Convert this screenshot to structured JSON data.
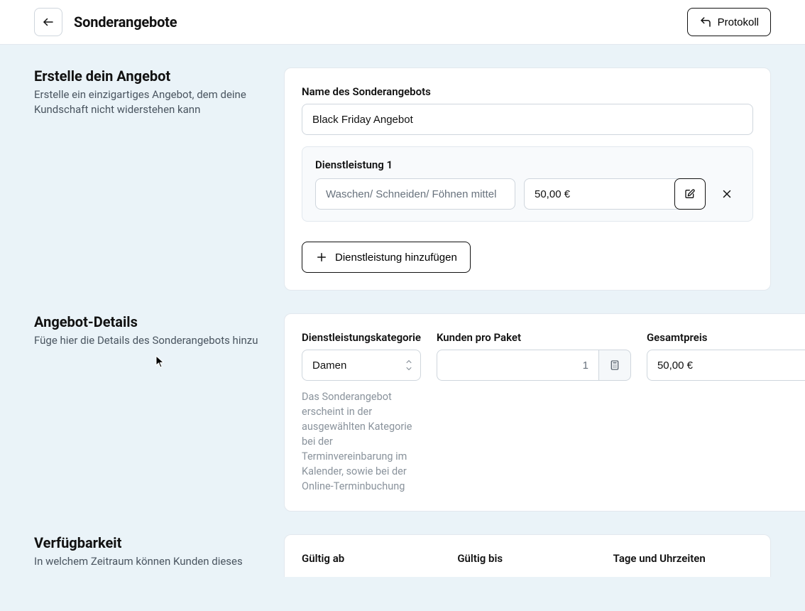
{
  "header": {
    "title": "Sonderangebote",
    "protocol_label": "Protokoll"
  },
  "section1": {
    "heading": "Erstelle dein Angebot",
    "desc": "Erstelle ein einzigartiges Angebot, dem deine Kundschaft nicht widerstehen kann",
    "name_label": "Name des Sonderangebots",
    "name_value": "Black Friday Angebot",
    "service_block_title": "Dienstleistung 1",
    "service_name": "Waschen/ Schneiden/ Föhnen mittel",
    "service_price": "50,00 €",
    "add_service_label": "Dienstleistung hinzufügen"
  },
  "section2": {
    "heading": "Angebot-Details",
    "desc": "Füge hier die Details des Sonderangebots hinzu",
    "category_label": "Dienstleistungskategorie",
    "category_value": "Damen",
    "category_helper": "Das Sonderangebot erscheint in der ausgewählten Kategorie bei der Terminvereinbarung im Kalender, sowie bei der Online-Terminbuchung",
    "customers_label": "Kunden pro Paket",
    "customers_value": "1",
    "total_label": "Gesamtpreis",
    "total_value": "50,00 €"
  },
  "section3": {
    "heading": "Verfügbarkeit",
    "desc": "In welchem Zeitraum können Kunden dieses",
    "valid_from_label": "Gültig ab",
    "valid_to_label": "Gültig bis",
    "days_times_label": "Tage und Uhrzeiten"
  }
}
